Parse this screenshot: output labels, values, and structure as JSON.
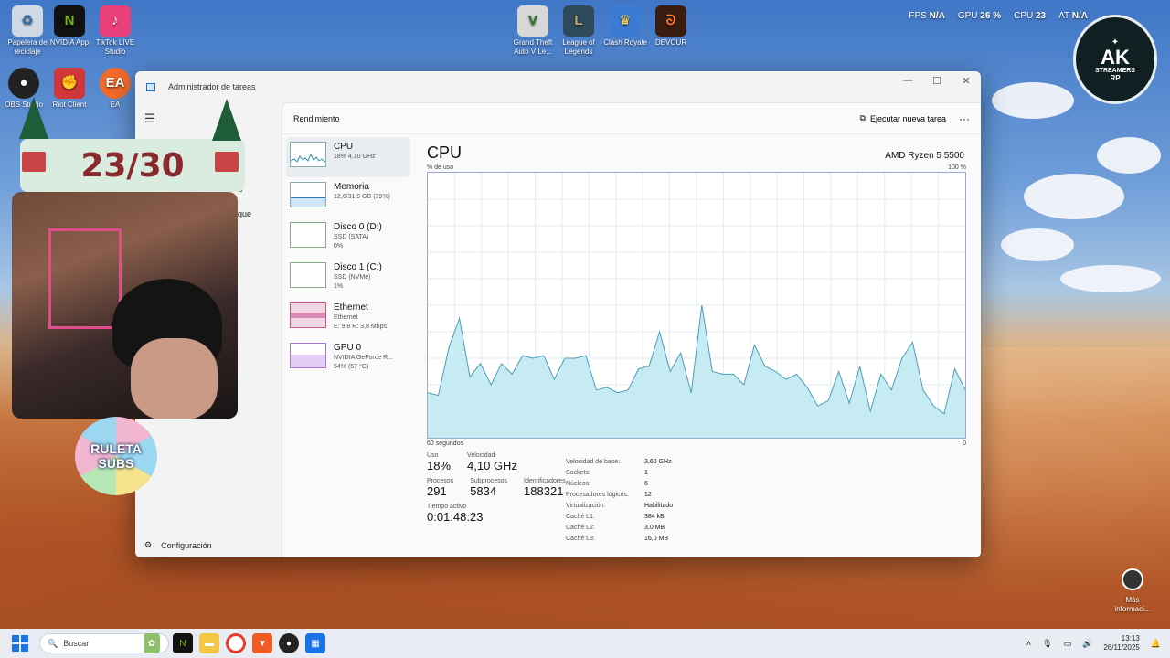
{
  "desktop": {
    "icons": [
      {
        "label": "Papelera de reciclaje",
        "glyph": "♻",
        "color": "#cfd8e3"
      },
      {
        "label": "NVIDIA App",
        "glyph": "N",
        "color": "#111111"
      },
      {
        "label": "TikTok LIVE Studio",
        "glyph": "♪",
        "color": "#e9407c"
      },
      {
        "label": "OBS Studio",
        "glyph": "●",
        "color": "#222222"
      },
      {
        "label": "Riot Client",
        "glyph": "✊",
        "color": "#d13639"
      },
      {
        "label": "EA",
        "glyph": "EA",
        "color": "#f26b2a"
      },
      {
        "label": "Grand Theft Auto V Le...",
        "glyph": "V",
        "color": "#d7d7d7"
      },
      {
        "label": "League of Legends",
        "glyph": "L",
        "color": "#2f4a5a"
      },
      {
        "label": "Clash Royale",
        "glyph": "♛",
        "color": "#3b7bd4"
      },
      {
        "label": "DEVOUR",
        "glyph": "ᘐ",
        "color": "#3a1c10"
      }
    ]
  },
  "hud": {
    "fps_label": "FPS",
    "fps_value": "N/A",
    "gpu_label": "GPU",
    "gpu_value": "26 %",
    "cpu_label": "CPU",
    "cpu_value": "23",
    "lat_label": "AT",
    "lat_value": "N/A"
  },
  "logo": {
    "line1": "AK",
    "line2": "STREAMERS",
    "line3": "RP"
  },
  "taskmgr": {
    "window_title": "Administrador de tareas",
    "section_title": "Rendimiento",
    "new_task": "Ejecutar nueva tarea",
    "more": "···",
    "settings": "Configuración",
    "nav_partial_1": "caciones",
    "nav_partial_2": "anque",
    "items": [
      {
        "name": "CPU",
        "sub1": "18% 4,10 GHz",
        "sub2": ""
      },
      {
        "name": "Memoria",
        "sub1": "12,6/31,9 GB (39%)",
        "sub2": ""
      },
      {
        "name": "Disco 0 (D:)",
        "sub1": "SSD (SATA)",
        "sub2": "0%"
      },
      {
        "name": "Disco 1 (C:)",
        "sub1": "SSD (NVMe)",
        "sub2": "1%"
      },
      {
        "name": "Ethernet",
        "sub1": "Ethernet",
        "sub2": "E: 9,8 R: 3,8 Mbps"
      },
      {
        "name": "GPU 0",
        "sub1": "NVIDIA GeForce R...",
        "sub2": "54% (57 °C)"
      }
    ],
    "detail": {
      "title": "CPU",
      "model": "AMD Ryzen 5 5500",
      "usage_label": "% de uso",
      "usage_max": "100 %",
      "time_label": "60 segundos",
      "time_end": "0",
      "uso_label": "Uso",
      "uso": "18%",
      "vel_label": "Velocidad",
      "vel": "4,10 GHz",
      "proc_label": "Procesos",
      "proc": "291",
      "sub_label": "Subprocesos",
      "sub": "5834",
      "id_label": "Identificadores",
      "id": "188321",
      "active_label": "Tiempo activo",
      "active": "0:01:48:23",
      "specs": [
        {
          "k": "Velocidad de base:",
          "v": "3,60 GHz"
        },
        {
          "k": "Sockets:",
          "v": "1"
        },
        {
          "k": "Núcleos:",
          "v": "6"
        },
        {
          "k": "Procesadores lógicos:",
          "v": "12"
        },
        {
          "k": "Virtualización:",
          "v": "Habilitado"
        },
        {
          "k": "Caché L1:",
          "v": "384 kB"
        },
        {
          "k": "Caché L2:",
          "v": "3,0 MB"
        },
        {
          "k": "Caché L3:",
          "v": "16,0 MB"
        }
      ]
    }
  },
  "chart_data": {
    "type": "area",
    "ylim": [
      0,
      100
    ],
    "values": [
      17,
      16,
      34,
      45,
      23,
      28,
      20,
      28,
      24,
      31,
      30,
      31,
      22,
      30,
      30,
      31,
      18,
      19,
      17,
      18,
      26,
      27,
      40,
      25,
      32,
      17,
      50,
      25,
      24,
      24,
      20,
      35,
      27,
      25,
      22,
      24,
      19,
      12,
      14,
      25,
      13,
      27,
      10,
      24,
      18,
      30,
      36,
      18,
      12,
      9,
      26,
      18
    ]
  },
  "overlay": {
    "counter": "23/30",
    "ruleta_1": "RULETA",
    "ruleta_2": "SUBS"
  },
  "taskbar": {
    "search_placeholder": "Buscar",
    "time": "13:13",
    "date": "26/11/2025"
  },
  "more_info": {
    "line1": "Más",
    "line2": "informaci..."
  }
}
